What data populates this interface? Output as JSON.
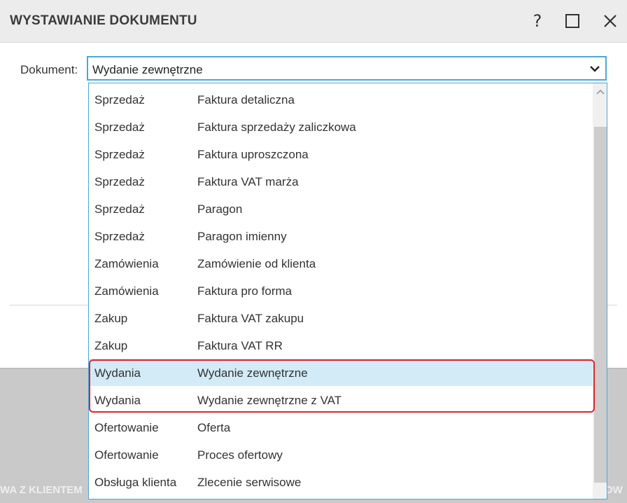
{
  "backdrop": {
    "left_text": "WA Z KLIENTEM",
    "right_text": "OW"
  },
  "dialog": {
    "title": "WYSTAWIANIE DOKUMENTU",
    "help_label": "?"
  },
  "form": {
    "document_label": "Dokument:",
    "document_value": "Wydanie zewnętrzne"
  },
  "dropdown": {
    "items": [
      {
        "category": "Sprzedaż",
        "name": "Faktura detaliczna"
      },
      {
        "category": "Sprzedaż",
        "name": "Faktura sprzedaży zaliczkowa"
      },
      {
        "category": "Sprzedaż",
        "name": "Faktura uproszczona"
      },
      {
        "category": "Sprzedaż",
        "name": "Faktura VAT marża"
      },
      {
        "category": "Sprzedaż",
        "name": "Paragon"
      },
      {
        "category": "Sprzedaż",
        "name": "Paragon imienny"
      },
      {
        "category": "Zamówienia",
        "name": "Zamówienie od klienta"
      },
      {
        "category": "Zamówienia",
        "name": "Faktura pro forma"
      },
      {
        "category": "Zakup",
        "name": "Faktura VAT zakupu"
      },
      {
        "category": "Zakup",
        "name": "Faktura VAT RR"
      },
      {
        "category": "Wydania",
        "name": "Wydanie zewnętrzne"
      },
      {
        "category": "Wydania",
        "name": "Wydanie zewnętrzne z VAT"
      },
      {
        "category": "Ofertowanie",
        "name": "Oferta"
      },
      {
        "category": "Ofertowanie",
        "name": "Proces ofertowy"
      },
      {
        "category": "Obsługa klienta",
        "name": "Zlecenie serwisowe"
      }
    ],
    "selected_index": 10
  },
  "colors": {
    "accent": "#4aa8d8",
    "selection": "#d3ebf7",
    "highlight": "#e0242c"
  }
}
